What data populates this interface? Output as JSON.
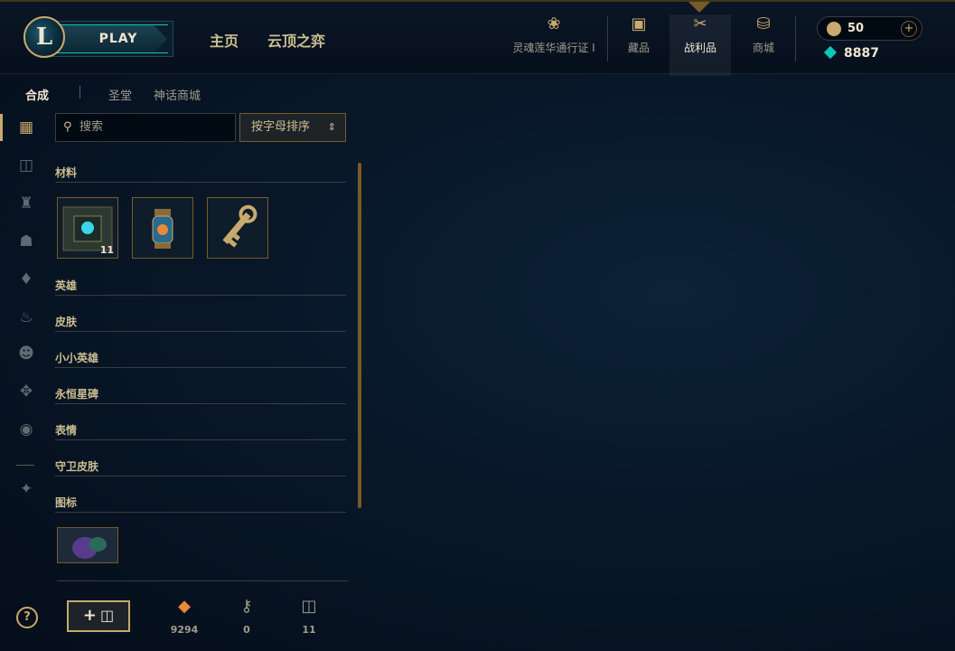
{
  "header": {
    "play_label": "PLAY",
    "nav_main": [
      "主页",
      "云顶之弈"
    ],
    "nav_icons": [
      {
        "label": "灵魂莲华通行证 I",
        "icon": "lotus-icon"
      },
      {
        "label": "藏品",
        "icon": "collection-bag-icon"
      },
      {
        "label": "战利品",
        "icon": "loot-icon",
        "active": true
      },
      {
        "label": "商城",
        "icon": "store-coins-icon"
      }
    ],
    "wallet_amount": "50",
    "wallet_plus": "+",
    "gems_amount": "8887"
  },
  "subtabs": [
    "合成",
    "圣堂",
    "神话商城"
  ],
  "rail_icons": [
    "grid-icon",
    "chest-icon",
    "helmet-icon",
    "mask-icon",
    "ward-icon",
    "flame-icon",
    "emote-face-icon",
    "totem-icon",
    "profile-icon",
    "crest-icon"
  ],
  "filters": {
    "search_placeholder": "搜索",
    "sort_label": "按字母排序"
  },
  "sections": {
    "materials": "材料",
    "champions": "英雄",
    "skins": "皮肤",
    "little_legends": "小小英雄",
    "eternals": "永恒星碑",
    "emotes": "表情",
    "ward_skins": "守卫皮肤",
    "icons": "图标"
  },
  "material_items": [
    {
      "name": "hextech-chest",
      "count": "11"
    },
    {
      "name": "lantern-orb",
      "count": ""
    },
    {
      "name": "golden-key",
      "count": ""
    }
  ],
  "footer": {
    "help": "?",
    "craft_label": "+",
    "currencies": [
      {
        "icon": "orange-essence-icon",
        "value": "9294",
        "color": "#e8893b"
      },
      {
        "icon": "key-fragment-icon",
        "value": "0",
        "color": "#a09b8c"
      },
      {
        "icon": "chest-icon",
        "value": "11",
        "color": "#a09b8c"
      }
    ]
  }
}
